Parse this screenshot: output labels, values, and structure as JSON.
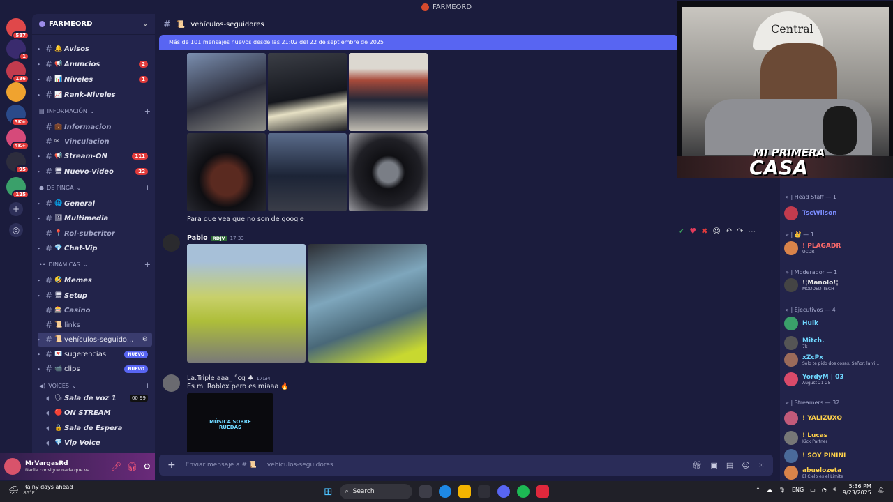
{
  "window_title": "FARMEORD",
  "servers": [
    {
      "badge": "587",
      "color": "#e0484a"
    },
    {
      "badge": "1",
      "color": "#3a2b6e"
    },
    {
      "badge": "136",
      "color": "#c23b4e"
    },
    {
      "badge": "",
      "color": "#f0a32f"
    },
    {
      "badge": "3K+",
      "color": "#2a4a8a"
    },
    {
      "badge": "4K+",
      "color": "#d64a7a"
    },
    {
      "badge": "95",
      "color": "#2d2d3d"
    },
    {
      "badge": "125",
      "color": "#3aa06a"
    }
  ],
  "guild": {
    "name": "FARMEORD"
  },
  "channels": [
    {
      "name": "Avisos",
      "emoji": "🔔",
      "count": "",
      "style": "italic",
      "new": false
    },
    {
      "name": "Anuncios",
      "emoji": "📢",
      "count": "2",
      "style": "italic",
      "new": false
    },
    {
      "name": "Niveles",
      "emoji": "📊",
      "count": "1",
      "style": "italic",
      "new": false
    },
    {
      "name": "Rank-Niveles",
      "emoji": "📈",
      "count": "",
      "style": "italic",
      "new": false
    },
    {
      "name": "Informacion",
      "emoji": "💼",
      "count": "",
      "style": "dim",
      "new": false
    },
    {
      "name": "Vinculacion",
      "emoji": "✉",
      "count": "",
      "style": "dim",
      "new": false
    },
    {
      "name": "Stream-ON",
      "emoji": "📢",
      "count": "111",
      "style": "italic",
      "new": false
    },
    {
      "name": "Nuevo-Video",
      "emoji": "🖥",
      "count": "22",
      "style": "italic",
      "new": false
    },
    {
      "name": "General",
      "emoji": "🌐",
      "count": "",
      "style": "italic",
      "new": false
    },
    {
      "name": "Multimedia",
      "emoji": "🖼",
      "count": "",
      "style": "italic",
      "new": false
    },
    {
      "name": "Rol-subcritor",
      "emoji": "📍",
      "count": "",
      "style": "dim",
      "new": false
    },
    {
      "name": "Chat-Vip",
      "emoji": "💎",
      "count": "",
      "style": "italic",
      "new": false
    },
    {
      "name": "Memes",
      "emoji": "🤣",
      "count": "",
      "style": "italic",
      "new": false
    },
    {
      "name": "Setup",
      "emoji": "🖥",
      "count": "",
      "style": "italic",
      "new": false
    },
    {
      "name": "Casino",
      "emoji": "🎰",
      "count": "",
      "style": "dim",
      "new": false
    },
    {
      "name": "links",
      "emoji": "📜",
      "count": "",
      "style": "plaindim",
      "new": false
    },
    {
      "name": "vehículos-seguido...",
      "emoji": "📜",
      "count": "",
      "style": "plain",
      "new": false
    },
    {
      "name": "sugerencias",
      "emoji": "💌",
      "count": "",
      "style": "plain",
      "new": true
    },
    {
      "name": "clips",
      "emoji": "📹",
      "count": "",
      "style": "plain",
      "new": true
    }
  ],
  "categories": {
    "info": "INFORMACIÓN",
    "depinga": "DE PINGA",
    "dinamicas": "DINAMICAS",
    "voices": "VOICES"
  },
  "voice_channels": [
    {
      "name": "Sala de voz 1",
      "emoji": "🗣",
      "extra": "00 99"
    },
    {
      "name": "ON STREAM",
      "emoji": "🔴",
      "extra": ""
    },
    {
      "name": "Sala de Espera",
      "emoji": "🔒",
      "extra": ""
    },
    {
      "name": "Vip Voice",
      "emoji": "💎",
      "extra": ""
    }
  ],
  "nuevo_label": "NUEVO",
  "user": {
    "name": "MrVargasRd",
    "status": "Nadie consigue nada que va..."
  },
  "topbar": {
    "channel": "vehículos-seguidores"
  },
  "banner": {
    "text": "Más de 101 mensajes nuevos desde las 21:02 del 22 de septiembre de 2025"
  },
  "messages": {
    "m1_text": "Para que vea que no son de google",
    "m2_author": "Pablo",
    "m2_tag": "RDJV",
    "m2_time": "17:33",
    "m3_author": "La.Triple aaa_ °cq ♣",
    "m3_time": "17:34",
    "m3_text": "Es mi Roblox pero es miaaa 🔥",
    "m3_thumb": "MÚSICA SOBRE RUEDAS"
  },
  "compose": {
    "placeholder": "Enviar mensaje a # 📜 ⋮ vehículos-seguidores"
  },
  "members": {
    "categories": [
      "» | Head Staff — 1",
      "» | 👑 — 1",
      "» | Moderador — 1",
      "» | Ejecutivos — 4",
      "» | Streamers — 32"
    ],
    "list": [
      {
        "name": "TscWilson",
        "sub": "",
        "color": "#7b8cff"
      },
      {
        "name": "! PLAGADR",
        "sub": "UCDR",
        "color": "#ff6b6b"
      },
      {
        "name": "!¦Manolo!¦",
        "sub": "MODDED TECH",
        "color": "#e6e6e6"
      },
      {
        "name": "Hulk",
        "sub": "",
        "color": "#6fd7ff"
      },
      {
        "name": "Mitch.",
        "sub": "7k",
        "color": "#6fd7ff"
      },
      {
        "name": "xZcPx",
        "sub": "Solo te pido dos cosas, Señor: la vi...",
        "color": "#6fd7ff"
      },
      {
        "name": "YordyM | 03",
        "sub": "August 21-25",
        "color": "#6fd7ff"
      },
      {
        "name": "! YALIZUXO",
        "sub": "",
        "color": "#ffd24a"
      },
      {
        "name": "! Lucas",
        "sub": "Kick Partner",
        "color": "#ffd24a"
      },
      {
        "name": "! SOY PININI",
        "sub": "",
        "color": "#ffd24a"
      },
      {
        "name": "abuelozeta",
        "sub": "El Cielo es el Limite",
        "color": "#ffd24a"
      }
    ]
  },
  "webcam": {
    "cap_text": "Central",
    "overlay_line1": "MI PRIMERA",
    "overlay_line2": "CASA"
  },
  "taskbar": {
    "weather_title": "Rainy days ahead",
    "weather_temp": "85°F",
    "search": "Search",
    "lang": "ENG",
    "time": "5:36 PM",
    "date": "9/23/2025"
  }
}
